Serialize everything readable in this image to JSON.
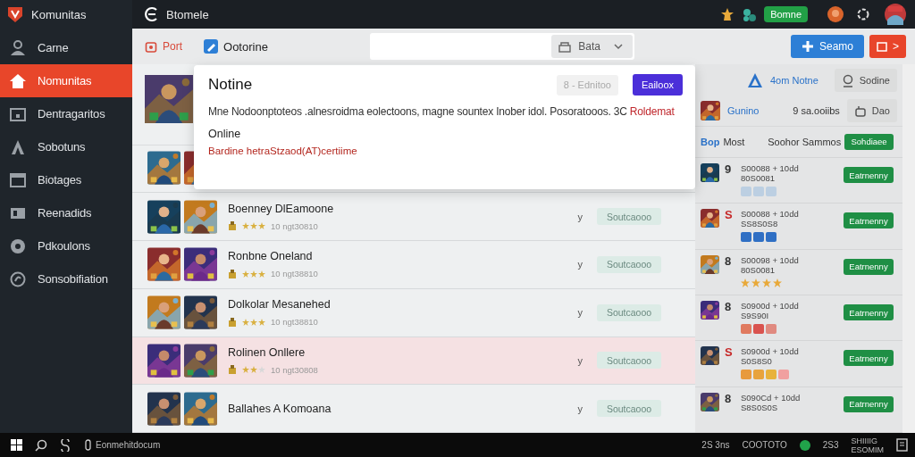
{
  "sidebar": {
    "app_name": "Komunitas",
    "items": [
      {
        "label": "Carne",
        "selected": false
      },
      {
        "label": "Nomunitas",
        "selected": true
      },
      {
        "label": "Dentragaritos",
        "selected": false
      },
      {
        "label": "Sobotuns",
        "selected": false
      },
      {
        "label": "Biotages",
        "selected": false
      },
      {
        "label": "Reenadids",
        "selected": false
      },
      {
        "label": "Pdkoulons",
        "selected": false
      },
      {
        "label": "Sonsobifiation",
        "selected": false
      }
    ]
  },
  "top_bar": {
    "title": "Btomele",
    "status_badge": "Bomne"
  },
  "toolbar": {
    "post_link": "Port",
    "channel_label": "Ootorine",
    "filter_button": "Bata",
    "primary_button": "Seamo",
    "next_button": ">"
  },
  "modal": {
    "title": "Notine",
    "secondary_button": "8 - Ednitoo",
    "primary_button": "Eailoox",
    "body": "Mne Nodoonptoteos .alnesroidma eolectoons, magne sountex Inober idol. Posoratooos. 3C",
    "body_link": "Roldemat",
    "status": "Online",
    "status_note": "Bardine hetraStzaod(AT)certiime"
  },
  "game_list": {
    "rows": [
      {
        "kind": "partial"
      },
      {
        "kind": "full",
        "title": "Boenney DlEamoone",
        "stars": 3,
        "meta": "10 ngt30810",
        "action_mark": "y",
        "action": "Soutcaooo",
        "highlighted": false
      },
      {
        "kind": "full",
        "title": "Ronbne Oneland",
        "stars": 3,
        "meta": "10 ngt38810",
        "action_mark": "y",
        "action": "Soutcaooo",
        "highlighted": false
      },
      {
        "kind": "full",
        "title": "Dolkolar Mesanehed",
        "stars": 3,
        "meta": "10 ngt38810",
        "action_mark": "y",
        "action": "Soutcaooo",
        "highlighted": false
      },
      {
        "kind": "full",
        "title": "Rolinen Onllere",
        "stars": 2,
        "meta": "10 ngt30808",
        "action_mark": "y",
        "action": "Soutcaooo",
        "highlighted": true
      },
      {
        "kind": "full",
        "title": "Ballahes A Komoana",
        "action_mark": "y",
        "action": "Soutcaooo",
        "highlighted": false
      }
    ]
  },
  "side_panel": {
    "title": "4om Notne",
    "title_button": "Sodine",
    "user": {
      "name": "Gunino",
      "count": "9 sa.ooiibs",
      "button": "Dao"
    },
    "column_1": "Bop",
    "column_2": "Most",
    "column_3": "Soohor Sammos",
    "header_button": "Sohdiaee",
    "rows": [
      {
        "rank": "9",
        "color": "#333333",
        "line_1": "S00088 + 10dd",
        "line_2": "80S0081",
        "chips": [
          {
            "color": "#bccfe2"
          },
          {
            "color": "#bccfe2"
          },
          {
            "color": "#bccfe2"
          }
        ],
        "button": "Eatrnenny"
      },
      {
        "rank": "S",
        "color": "#c62828",
        "line_1": "S00088 + 10dd",
        "line_2": "SS8S0S8",
        "chips": [
          {
            "color": "#2f6fc4"
          },
          {
            "color": "#2f6fc4"
          },
          {
            "color": "#2f6fc4"
          }
        ],
        "button": "Eatrnenny"
      },
      {
        "rank": "8",
        "color": "#333333",
        "line_1": "S00098 + 10dd",
        "line_2": "80S0081",
        "stars": 4,
        "button": "Eatrnenny"
      },
      {
        "rank": "8",
        "color": "#333333",
        "line_1": "S0900d + 10dd",
        "line_2": "S9S90I",
        "chips": [
          {
            "color": "#e07a5f"
          },
          {
            "color": "#d9534f"
          },
          {
            "color": "#e08a80"
          }
        ],
        "button": "Eatrnenny"
      },
      {
        "rank": "S",
        "color": "#c62828",
        "line_1": "S0900d + 10dd",
        "line_2": "S0S8S0",
        "chips": [
          {
            "color": "#e89a3c"
          },
          {
            "color": "#e8a33c"
          },
          {
            "color": "#e8b23c"
          },
          {
            "color": "#f0a0a0"
          }
        ],
        "button": "Eatrnenny"
      },
      {
        "rank": "8",
        "color": "#333333",
        "line_1": "S090Cd + 10dd",
        "line_2": "S8S0S0S",
        "button": "Eatrnenny"
      }
    ]
  },
  "taskbar": {
    "app_label": "Eonmehitdocum",
    "tray": [
      "2S 3ns",
      "COOTOTO",
      "2S3"
    ],
    "clock": [
      "SHIIIIG",
      "ESOMIM"
    ]
  }
}
